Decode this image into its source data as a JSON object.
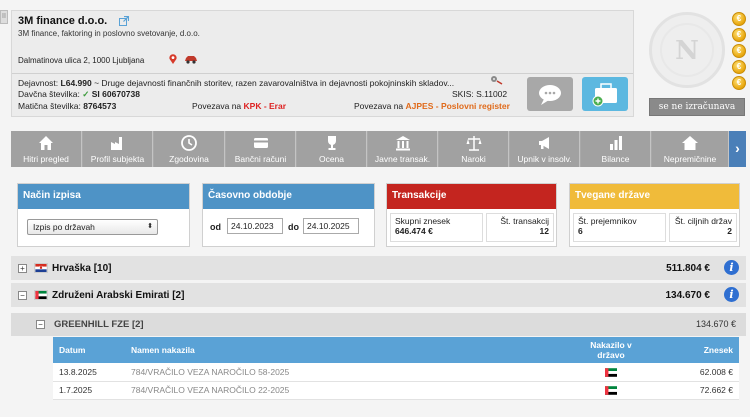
{
  "side_tab": "II",
  "company": {
    "name": "3M finance d.o.o.",
    "description": "3M finance, faktoring in poslovno svetovanje, d.o.o.",
    "address": "Dalmatinova ulica 2, 1000 Ljubljana",
    "activity_label": "Dejavnost:",
    "activity_code": "L64.990",
    "activity_text": " ~ Druge dejavnosti finančnih storitev, razen zavarovalništva in dejavnosti pokojninskih skladov...",
    "tax_label": "Davčna številka:",
    "tax_check": "✓",
    "tax_number": "SI 60670738",
    "reg_label": "Matična številka:",
    "reg_number": "8764573",
    "kpk_prefix": "Povezava na ",
    "kpk_link": "KPK - Erar",
    "skis": "SKIS: S.11002",
    "ajpes_prefix": "Povezava na ",
    "ajpes_link": "AJPES - Poslovni register"
  },
  "seal_letter": "N",
  "coins": [
    "€",
    "€",
    "€",
    "€",
    "€"
  ],
  "calc_button": "se ne izračunava",
  "tabs": [
    {
      "label": "Hitri pregled",
      "icon": "home-icon"
    },
    {
      "label": "Profil subjekta",
      "icon": "factory-icon"
    },
    {
      "label": "Zgodovina",
      "icon": "clock-icon"
    },
    {
      "label": "Bančni računi",
      "icon": "bank-card-icon"
    },
    {
      "label": "Ocena",
      "icon": "trophy-icon"
    },
    {
      "label": "Javne transak.",
      "icon": "government-icon"
    },
    {
      "label": "Naroki",
      "icon": "scales-icon"
    },
    {
      "label": "Upnik v insolv.",
      "icon": "megaphone-icon"
    },
    {
      "label": "Bilance",
      "icon": "bar-chart-icon"
    },
    {
      "label": "Nepremičnine",
      "icon": "house-icon"
    }
  ],
  "tab_arrow": "›",
  "filters": {
    "mode_title": "Način izpisa",
    "mode_value": "Izpis po državah",
    "mode_arrow": "⬍",
    "period_title": "Časovno obdobje",
    "from_label": "od",
    "from_value": "24.10.2023",
    "to_label": "do",
    "to_value": "24.10.2025"
  },
  "transactions_panel": {
    "title": "Transakcije",
    "total_label": "Skupni znesek",
    "total_value": "646.474 €",
    "count_label": "Št. transakcij",
    "count_value": "12"
  },
  "risk_panel": {
    "title": "Tvegane države",
    "recipients_label": "Št. prejemnikov",
    "recipients_value": "6",
    "target_label": "Št. ciljnih držav",
    "target_value": "2"
  },
  "countries": [
    {
      "toggle": "+",
      "name": "Hrvaška [10]",
      "amount": "511.804 €"
    },
    {
      "toggle": "−",
      "name": "Združeni Arabski Emirati [2]",
      "amount": "134.670 €"
    }
  ],
  "info_glyph": "i",
  "recipient": {
    "toggle": "−",
    "name": "GREENHILL FZE [2]",
    "amount": "134.670 €"
  },
  "table": {
    "headers": {
      "date": "Datum",
      "purpose": "Namen nakazila",
      "country": "Nakazilo v državo",
      "amount": "Znesek"
    },
    "rows": [
      {
        "date": "13.8.2025",
        "purpose": "784/VRAČILO VEZA NAROČILO 58-2025",
        "amount": "62.008 €"
      },
      {
        "date": "1.7.2025",
        "purpose": "784/VRAČILO VEZA NAROČILO 22-2025",
        "amount": "72.662 €"
      }
    ]
  },
  "colors": {
    "filter_header": "#4e93c6",
    "transactions_header": "#c4251f",
    "risk_header": "#f0bb3a",
    "table_header": "#5aa2d6",
    "tab_bg": "#a1a1a1",
    "tab_arrow": "#4a7fb8"
  }
}
